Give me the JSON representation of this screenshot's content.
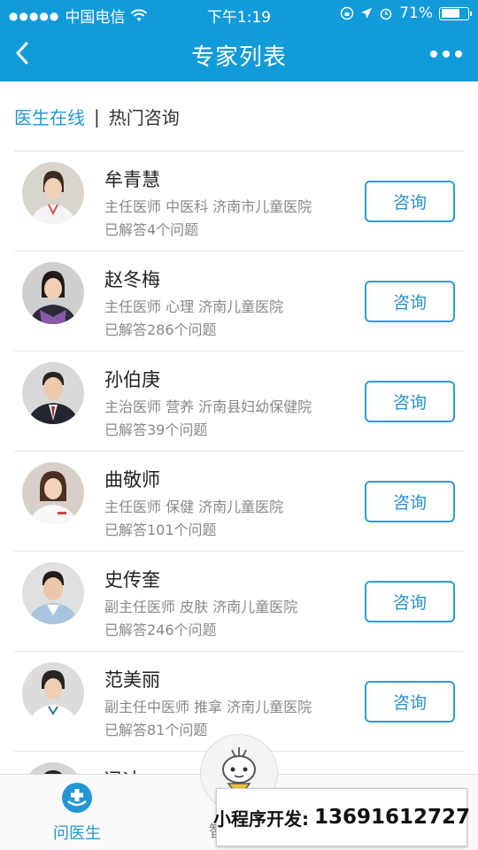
{
  "status_bar": {
    "carrier": "中国电信",
    "time": "下午1:19",
    "battery": "71%",
    "battery_level": 0.71
  },
  "nav": {
    "title": "专家列表"
  },
  "tabs": {
    "active": "医生在线",
    "separator": "|",
    "other": "热门咨询"
  },
  "doctors": [
    {
      "name": "牟青慧",
      "meta": "主任医师 中医科 济南市儿童医院",
      "answered": "已解答4个问题",
      "action": "咨询"
    },
    {
      "name": "赵冬梅",
      "meta": "主任医师 心理 济南儿童医院",
      "answered": "已解答286个问题",
      "action": "咨询"
    },
    {
      "name": "孙伯庚",
      "meta": "主治医师 营养 沂南县妇幼保健院",
      "answered": "已解答39个问题",
      "action": "咨询"
    },
    {
      "name": "曲敬师",
      "meta": "主任医师 保健 济南儿童医院",
      "answered": "已解答101个问题",
      "action": "咨询"
    },
    {
      "name": "史传奎",
      "meta": "副主任医师 皮肤 济南儿童医院",
      "answered": "已解答246个问题",
      "action": "咨询"
    },
    {
      "name": "范美丽",
      "meta": "副主任中医师 推拿 济南儿童医院",
      "answered": "已解答81个问题",
      "action": "咨询"
    }
  ],
  "partial_row": {
    "name": "冯冰"
  },
  "bottom_tabs": {
    "doctor_label": "问医生",
    "ai_label_partial": "智"
  },
  "watermark": {
    "label": "小程序开发:",
    "phone": "13691612727"
  },
  "colors": {
    "brand_blue": "#129bd9",
    "link_blue": "#2397d6"
  }
}
